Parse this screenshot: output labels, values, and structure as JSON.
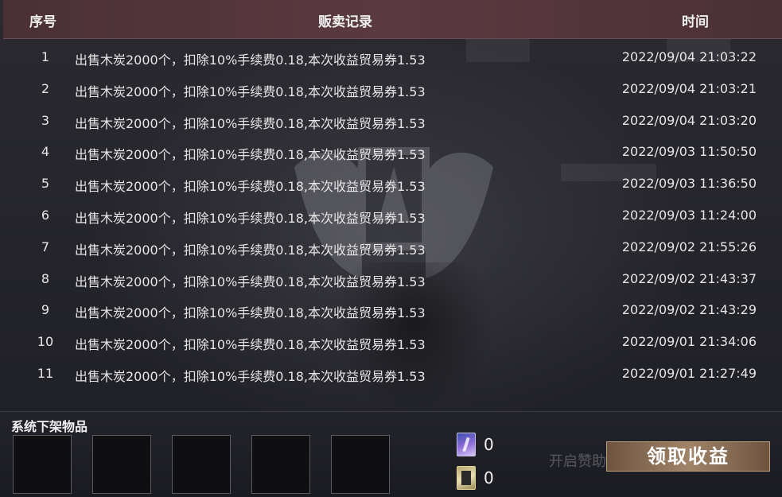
{
  "table": {
    "headers": {
      "index": "序号",
      "record": "贩卖记录",
      "time": "时间"
    },
    "rows": [
      {
        "index": "1",
        "record": "出售木炭2000个，扣除10%手续费0.18,本次收益贸易券1.53",
        "time": "2022/09/04 21:03:22"
      },
      {
        "index": "2",
        "record": "出售木炭2000个，扣除10%手续费0.18,本次收益贸易券1.53",
        "time": "2022/09/04 21:03:21"
      },
      {
        "index": "3",
        "record": "出售木炭2000个，扣除10%手续费0.18,本次收益贸易券1.53",
        "time": "2022/09/04 21:03:20"
      },
      {
        "index": "4",
        "record": "出售木炭2000个，扣除10%手续费0.18,本次收益贸易券1.53",
        "time": "2022/09/03 11:50:50"
      },
      {
        "index": "5",
        "record": "出售木炭2000个，扣除10%手续费0.18,本次收益贸易券1.53",
        "time": "2022/09/03 11:36:50"
      },
      {
        "index": "6",
        "record": "出售木炭2000个，扣除10%手续费0.18,本次收益贸易券1.53",
        "time": "2022/09/03 11:24:00"
      },
      {
        "index": "7",
        "record": "出售木炭2000个，扣除10%手续费0.18,本次收益贸易券1.53",
        "time": "2022/09/02 21:55:26"
      },
      {
        "index": "8",
        "record": "出售木炭2000个，扣除10%手续费0.18,本次收益贸易券1.53",
        "time": "2022/09/02 21:43:37"
      },
      {
        "index": "9",
        "record": "出售木炭2000个，扣除10%手续费0.18,本次收益贸易券1.53",
        "time": "2022/09/02 21:43:29"
      },
      {
        "index": "10",
        "record": "出售木炭2000个，扣除10%手续费0.18,本次收益贸易券1.53",
        "time": "2022/09/01 21:34:06"
      },
      {
        "index": "11",
        "record": "出售木炭2000个，扣除10%手续费0.18,本次收益贸易券1.53",
        "time": "2022/09/01 21:27:49"
      }
    ]
  },
  "bottom": {
    "title": "系统下架物品",
    "slots_count": 5,
    "currencies": [
      {
        "icon": "trade-ticket-icon",
        "value": "0"
      },
      {
        "icon": "card-icon",
        "value": "0"
      }
    ],
    "background_text": "开启赞助",
    "claim_button": "领取收益"
  },
  "colors": {
    "header_bg": "#4a3035",
    "claim_button": "#a08468",
    "text": "#e6e6e6"
  }
}
